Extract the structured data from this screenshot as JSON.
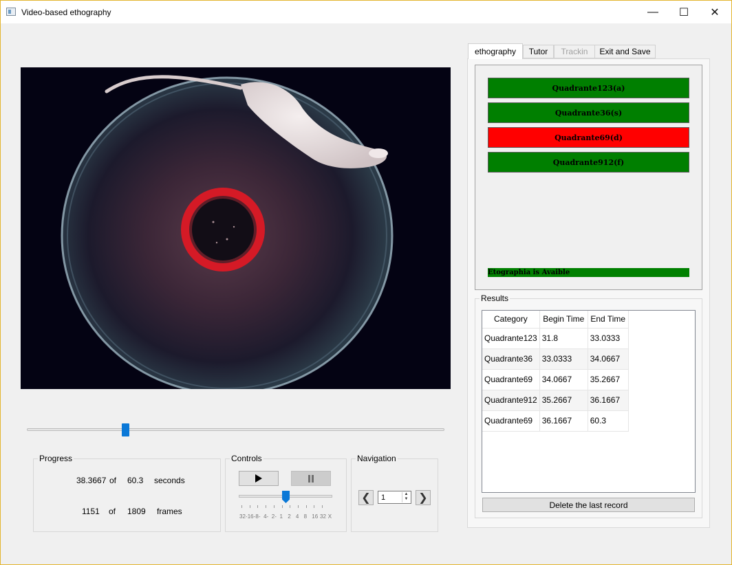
{
  "window": {
    "title": "Video-based ethography",
    "minimize": "—",
    "maximize": "☐",
    "close": "✕"
  },
  "progress": {
    "title": "Progress",
    "current_seconds": "38.3667",
    "of1": "of",
    "total_seconds": "60.3",
    "seconds_unit": "seconds",
    "current_frame": "1151",
    "of2": "of",
    "total_frames": "1809",
    "frames_unit": "frames",
    "position_fraction": 0.236
  },
  "controls": {
    "title": "Controls",
    "play_icon": "play-icon",
    "pause_icon": "pause-icon",
    "speed_labels": [
      "32-",
      "16-",
      "8-",
      "4-",
      "2-",
      "1",
      "2",
      "4",
      "8",
      "16",
      "32",
      "X"
    ],
    "speed_selected": "1"
  },
  "navigation": {
    "title": "Navigation",
    "prev": "❮",
    "next": "❯",
    "step_value": "1"
  },
  "tabs": [
    {
      "label": "ethography",
      "state": "active"
    },
    {
      "label": "Tutor",
      "state": "normal"
    },
    {
      "label": "Trackin",
      "state": "disabled"
    },
    {
      "label": "Exit and Save",
      "state": "normal"
    }
  ],
  "ethography": {
    "buttons": [
      {
        "label": "Quadrante123(a)",
        "color": "#007f00"
      },
      {
        "label": "Quadrante36(s)",
        "color": "#007f00"
      },
      {
        "label": "Quadrante69(d)",
        "color": "#ff0000"
      },
      {
        "label": "Quadrante912(f)",
        "color": "#007f00"
      }
    ],
    "status": "Etographia is Avaible",
    "status_color": "#008000"
  },
  "results": {
    "title": "Results",
    "headers": [
      "Category",
      "Begin Time",
      "End Time"
    ],
    "rows": [
      [
        "Quadrante123",
        "31.8",
        "33.0333"
      ],
      [
        "Quadrante36",
        "33.0333",
        "34.0667"
      ],
      [
        "Quadrante69",
        "34.0667",
        "35.2667"
      ],
      [
        "Quadrante912",
        "35.2667",
        "36.1667"
      ],
      [
        "Quadrante69",
        "36.1667",
        "60.3"
      ]
    ],
    "delete_label": "Delete the last record"
  }
}
